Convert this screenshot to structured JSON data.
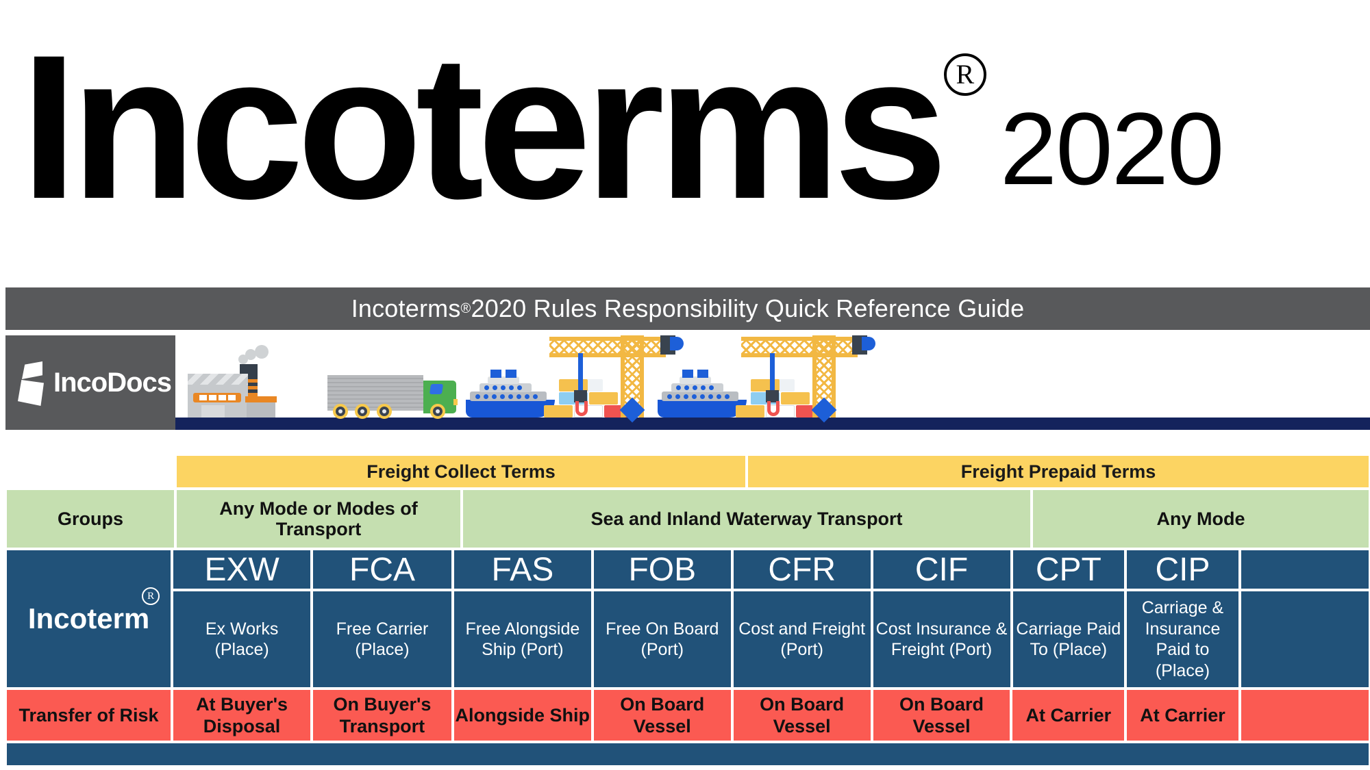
{
  "title": {
    "main": "Incoterms",
    "registered_mark": "R",
    "year": "2020"
  },
  "banner": {
    "text_before": "Incoterms",
    "registered_mark": "®",
    "text_after": "2020 Rules Responsibility Quick Reference Guide"
  },
  "brand": {
    "name": "IncoDocs",
    "logo_icon": "inco-flag-icon"
  },
  "illustration": {
    "items": [
      "factory-icon",
      "truck-icon",
      "container-ship-icon",
      "port-crane-icon",
      "container-ship-icon",
      "port-crane-icon"
    ],
    "colors": {
      "ground": "#14235c",
      "crane": "#f2b843",
      "ship_hull": "#1857d6",
      "truck_cab": "#4caf50",
      "factory_accent": "#e98724"
    }
  },
  "palette": {
    "banner_grey": "#58595b",
    "yellow": "#fcd462",
    "green": "#c5dfb0",
    "blue": "#215279",
    "red": "#fb5a52"
  },
  "table": {
    "freight_groups": [
      {
        "label": "Freight Collect Terms"
      },
      {
        "label": "Freight Prepaid Terms"
      }
    ],
    "groups_row": {
      "header": "Groups",
      "cells": [
        "Any Mode or Modes of Transport",
        "Sea and Inland Waterway Transport",
        "Any Mode"
      ]
    },
    "incoterm_row": {
      "header": "Incoterm",
      "registered_mark": "R",
      "terms": [
        {
          "code": "EXW",
          "name": "Ex Works (Place)"
        },
        {
          "code": "FCA",
          "name": "Free Carrier (Place)"
        },
        {
          "code": "FAS",
          "name": "Free Alongside Ship (Port)"
        },
        {
          "code": "FOB",
          "name": "Free On Board (Port)"
        },
        {
          "code": "CFR",
          "name": "Cost and Freight (Port)"
        },
        {
          "code": "CIF",
          "name": "Cost Insurance & Freight (Port)"
        },
        {
          "code": "CPT",
          "name": "Carriage Paid To (Place)"
        },
        {
          "code": "CIP",
          "name": "Carriage & Insurance Paid to (Place)"
        }
      ]
    },
    "risk_row": {
      "header": "Transfer of Risk",
      "values": [
        "At Buyer's Disposal",
        "On Buyer's Transport",
        "Alongside Ship",
        "On Board Vessel",
        "On Board Vessel",
        "On Board Vessel",
        "At Carrier",
        "At Carrier"
      ]
    }
  }
}
